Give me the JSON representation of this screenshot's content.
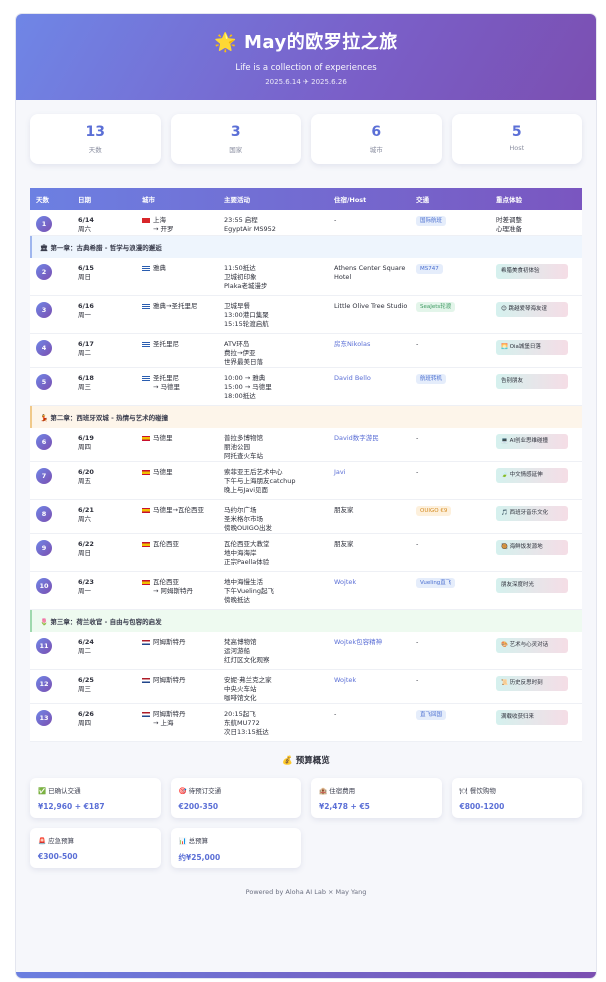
{
  "header": {
    "title": "🌟 May的欧罗拉之旅",
    "subtitle": "Life is a collection of experiences",
    "dates": "2025.6.14 ✈ 2025.6.26"
  },
  "stats": [
    {
      "num": "13",
      "label": "天数"
    },
    {
      "num": "3",
      "label": "国家"
    },
    {
      "num": "6",
      "label": "城市"
    },
    {
      "num": "5",
      "label": "Host"
    }
  ],
  "table": {
    "headers": [
      "天数",
      "日期",
      "城市",
      "主要活动",
      "住宿/Host",
      "交通",
      "重点体验"
    ]
  },
  "chapters": {
    "ch1": "🏛 第一章：古典希腊 - 哲学与浪漫的邂逅",
    "ch2": "💃 第二章：西班牙双城 - 热情与艺术的碰撞",
    "ch3": "🌷 第三章：荷兰收官 - 自由与包容的启发"
  },
  "days": [
    {
      "n": "1",
      "date": "6/14",
      "wd": "周六",
      "city": "上海",
      "city2": "→ 开罗",
      "act": [
        "23:55 启程",
        "EgyptAir MS952"
      ],
      "host": "-",
      "trans": "国际航班",
      "exp": [
        "时差调整",
        "心理准备"
      ]
    },
    {
      "n": "2",
      "date": "6/15",
      "wd": "周日",
      "city": "雅典",
      "city2": "",
      "act": [
        "11:50抵达",
        "卫城初印象",
        "Plaka老城漫步"
      ],
      "host": "Athens Center Square Hotel",
      "trans": "MS747",
      "exp": [
        "希腊美食初体验"
      ]
    },
    {
      "n": "3",
      "date": "6/16",
      "wd": "周一",
      "city": "雅典→圣托里尼",
      "city2": "",
      "act": [
        "卫城早餐",
        "13:00港口集聚",
        "15:15轮渡启航"
      ],
      "host": "Little Olive Tree Studio",
      "trans": "SeaJets轮渡",
      "exp": [
        "😊 跳越爱琴海友谊"
      ]
    },
    {
      "n": "4",
      "date": "6/17",
      "wd": "周二",
      "city": "圣托里尼",
      "city2": "",
      "act": [
        "ATV环岛",
        "费拉→伊亚",
        "世界最美日落"
      ],
      "host": "房东Nikolas",
      "trans": "-",
      "exp": [
        "🌅 Oia城堡日落"
      ]
    },
    {
      "n": "5",
      "date": "6/18",
      "wd": "周三",
      "city": "圣托里尼",
      "city2": "→ 马德里",
      "act": [
        "10:00 → 雅典",
        "15:00 → 马德里",
        "18:00抵达"
      ],
      "host": "David Bello",
      "trans": "航班转机",
      "exp": [
        "告别朋友"
      ]
    },
    {
      "n": "6",
      "date": "6/19",
      "wd": "周四",
      "city": "马德里",
      "city2": "",
      "act": [
        "普拉多博物馆",
        "丽池公园",
        "阿托查火车站"
      ],
      "host": "David数字游民",
      "trans": "-",
      "exp": [
        "💻 AI创业思维碰撞"
      ]
    },
    {
      "n": "7",
      "date": "6/20",
      "wd": "周五",
      "city": "马德里",
      "city2": "",
      "act": [
        "索菲亚王后艺术中心",
        "下午与上海朋友catchup",
        "晚上与Javi见面"
      ],
      "host": "Javi",
      "trans": "-",
      "exp": [
        "🍃 中文情感延伸"
      ]
    },
    {
      "n": "8",
      "date": "6/21",
      "wd": "周六",
      "city": "马德里→瓦伦西亚",
      "city2": "",
      "act": [
        "马约尔广场",
        "圣米格尔市场",
        "傍晚OUIGO出发"
      ],
      "host": "朋友家",
      "trans": "OUIGO €9",
      "exp": [
        "🎵 西班牙音乐文化"
      ]
    },
    {
      "n": "9",
      "date": "6/22",
      "wd": "周日",
      "city": "瓦伦西亚",
      "city2": "",
      "act": [
        "瓦伦西亚大教堂",
        "地中海海岸",
        "正宗Paella体验"
      ],
      "host": "朋友家",
      "trans": "-",
      "exp": [
        "🥘 海鲜饭发源地"
      ]
    },
    {
      "n": "10",
      "date": "6/23",
      "wd": "周一",
      "city": "瓦伦西亚",
      "city2": "→ 阿姆斯特丹",
      "act": [
        "地中海慢生活",
        "下午Vueling起飞",
        "傍晚抵达"
      ],
      "host": "Wojtek",
      "trans": "Vueling直飞",
      "exp": [
        "朋友深度时光"
      ]
    },
    {
      "n": "11",
      "date": "6/24",
      "wd": "周二",
      "city": "阿姆斯特丹",
      "city2": "",
      "act": [
        "梵高博物馆",
        "运河游船",
        "红灯区文化观察"
      ],
      "host": "Wojtek包容精神",
      "trans": "-",
      "exp": [
        "🎨 艺术与心灵对话"
      ]
    },
    {
      "n": "12",
      "date": "6/25",
      "wd": "周三",
      "city": "阿姆斯特丹",
      "city2": "",
      "act": [
        "安妮·弗兰克之家",
        "中央火车站",
        "咖啡馆文化"
      ],
      "host": "Wojtek",
      "trans": "-",
      "exp": [
        "📜 历史反思时刻"
      ]
    },
    {
      "n": "13",
      "date": "6/26",
      "wd": "周四",
      "city": "阿姆斯特丹",
      "city2": "→ 上海",
      "act": [
        "20:15起飞",
        "东航MU772",
        "次日13:15抵达"
      ],
      "host": "-",
      "trans": "直飞回国",
      "exp": [
        "满载收获归来"
      ]
    }
  ],
  "budget": {
    "title": "💰 预算概览",
    "items": [
      {
        "t": "✅ 已确认交通",
        "v": "¥12,960 + €187"
      },
      {
        "t": "🎯 待预订交通",
        "v": "€200-350"
      },
      {
        "t": "🏨 住宿费用",
        "v": "¥2,478 + €5"
      },
      {
        "t": "🍽 餐饮购物",
        "v": "€800-1200"
      },
      {
        "t": "🚨 应急预算",
        "v": "€300-500"
      },
      {
        "t": "📊 总预算",
        "v": "约¥25,000"
      }
    ]
  },
  "footer": "Powered by Aloha AI Lab × May Yang"
}
